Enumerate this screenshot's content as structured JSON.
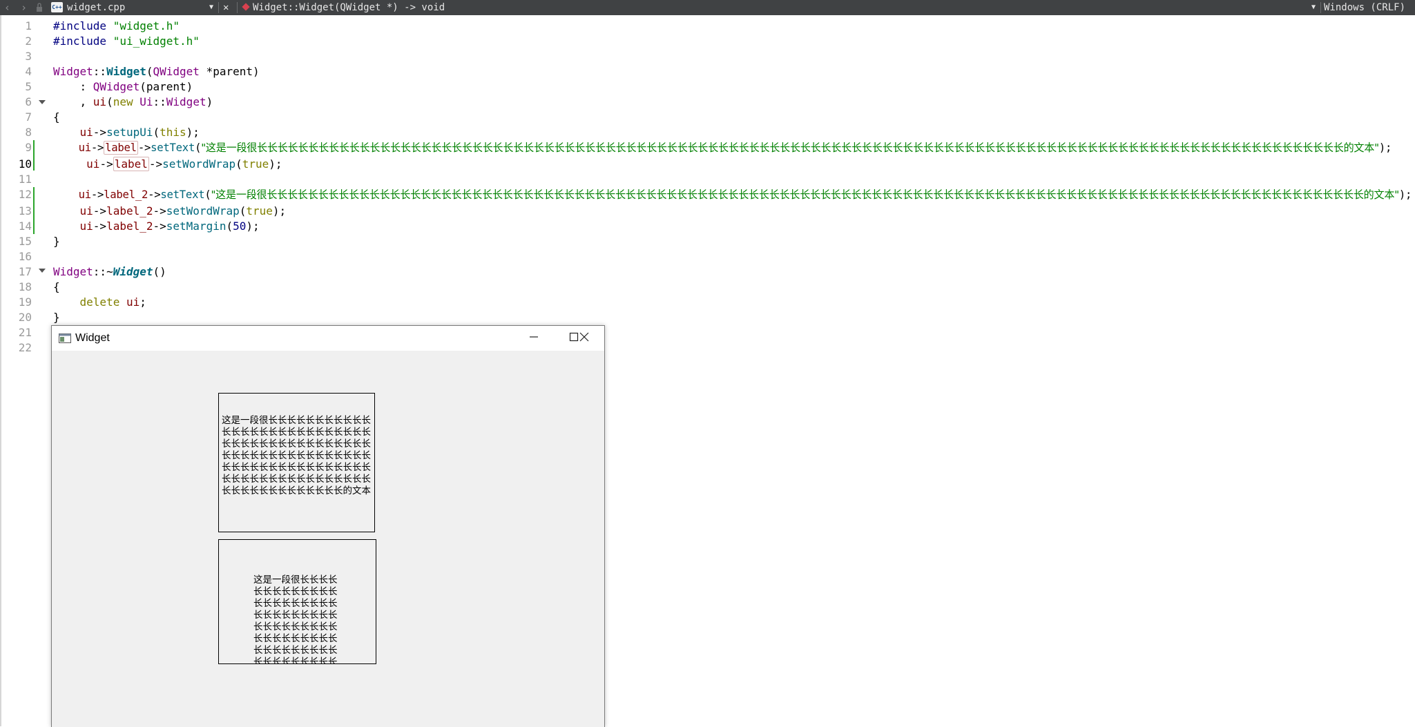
{
  "toolbar": {
    "back_icon": "chevron-left-icon",
    "forward_icon": "chevron-right-icon",
    "lock_icon": "lock-icon",
    "file_icon_text": "C++",
    "file_name": "widget.cpp",
    "dropdown_icon": "triangle-down-icon",
    "close_icon": "close-icon",
    "symbol": "Widget::Widget(QWidget *) -> void",
    "line_ending": "Windows (CRLF)"
  },
  "editor": {
    "current_line": 10,
    "line_numbers": [
      "1",
      "2",
      "3",
      "4",
      "5",
      "6",
      "7",
      "8",
      "9",
      "10",
      "11",
      "12",
      "13",
      "14",
      "15",
      "16",
      "17",
      "18",
      "19",
      "20",
      "21",
      "22"
    ],
    "lines": {
      "l1": {
        "pre": "#include ",
        "str": "\"widget.h\""
      },
      "l2": {
        "pre": "#include ",
        "str": "\"ui_widget.h\""
      },
      "l4": {
        "cls": "Widget",
        "sep": "::",
        "fn": "Widget",
        "p1": "(",
        "cls2": "QWidget",
        "rest": " *parent)"
      },
      "l5": {
        "indent": "    : ",
        "cls": "QWidget",
        "rest": "(parent)"
      },
      "l6": {
        "indent": "    , ",
        "mem": "ui",
        "p1": "(",
        "kw": "new",
        "sp": " ",
        "cls": "Ui",
        "sep": "::",
        "cls2": "Widget",
        "rest": ")"
      },
      "l7": "{",
      "l8": {
        "indent": "    ",
        "mem": "ui",
        "arrow": "->",
        "fn": "setupUi",
        "p1": "(",
        "kw": "this",
        "rest": ");"
      },
      "l9": {
        "indent": "    ",
        "mem": "ui",
        "arrow": "->",
        "hl": "label",
        "arrow2": "->",
        "fn": "setText",
        "p1": "(",
        "str": "\"这是一段很长长长长长长长长长长长长长长长长长长长长长长长长长长长长长长长长长长长长长长长长长长长长长长长长长长长长长长长长长长长长长长长长长长长长长长长长长长长长长长长长长长长长长长长长长长长长长长长长长长长长长长长长长长的文本\"",
        "rest": ");"
      },
      "l10": {
        "indent": "     ",
        "mem": "ui",
        "arrow": "->",
        "hl": "label",
        "arrow2": "->",
        "fn": "setWordWrap",
        "p1": "(",
        "kw": "true",
        "rest": ");"
      },
      "l12": {
        "indent": "    ",
        "mem": "ui",
        "arrow": "->",
        "mem2": "label_2",
        "arrow2": "->",
        "fn": "setText",
        "p1": "(",
        "str": "\"这是一段很长长长长长长长长长长长长长长长长长长长长长长长长长长长长长长长长长长长长长长长长长长长长长长长长长长长长长长长长长长长长长长长长长长长长长长长长长长长长长长长长长长长长长长长长长长长长长长长长长长长长长长长长长长长的文本\"",
        "rest": ");"
      },
      "l13": {
        "indent": "    ",
        "mem": "ui",
        "arrow": "->",
        "mem2": "label_2",
        "arrow2": "->",
        "fn": "setWordWrap",
        "p1": "(",
        "kw": "true",
        "rest": ");"
      },
      "l14": {
        "indent": "    ",
        "mem": "ui",
        "arrow": "->",
        "mem2": "label_2",
        "arrow2": "->",
        "fn": "setMargin",
        "p1": "(",
        "num": "50",
        "rest": ");"
      },
      "l15": "}",
      "l17": {
        "cls": "Widget",
        "sep": "::~",
        "fn": "Widget",
        "rest": "()"
      },
      "l18": "{",
      "l19": {
        "indent": "    ",
        "kw": "delete",
        "sp": " ",
        "mem": "ui",
        "rest": ";"
      },
      "l20": "}"
    }
  },
  "widget_window": {
    "app_icon": "qt-window-icon",
    "title": "Widget",
    "minimize_icon": "minimize-icon",
    "maximize_icon": "maximize-icon",
    "close_icon": "close-icon",
    "label_text": "这是一段很长长长长长长长长长长长长长长长长长长长长长长长长长长长长长长长长长长长长长长长长长长长长长长长长长长长长长长长长长长长长长长长长长长长长长长长长长长长长长长长长长长长长长长长长长长长长长长长长长长长长长长长长的文本",
    "label_2_text": "这是一段很长长长长长长长长长长长长长长长长长长长长长长长长长长长长长长长长长长长长长长长长长长长长长长长长长长长长长长长长长长长长长长长长长长长长长长长长长长长长长长长长长长长长长长长长长长长长长长长长长长长长长长长长长的文本"
  },
  "colors": {
    "toolbar_bg": "#404244",
    "string": "#008000",
    "preprocessor": "#000080",
    "class": "#800080",
    "function": "#00677c",
    "keyword": "#808000",
    "member": "#800000",
    "change_marker": "#2aa52a",
    "window_bg": "#f0f0f0"
  }
}
